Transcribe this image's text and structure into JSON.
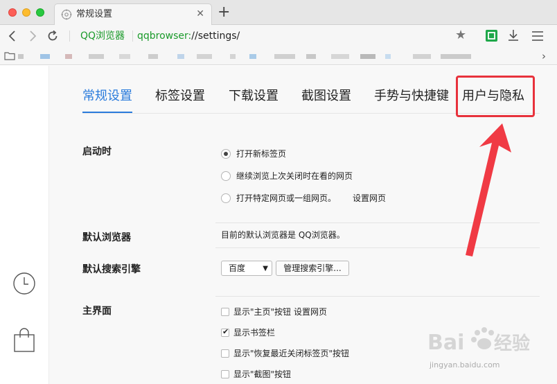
{
  "browser": {
    "tab": {
      "title": "常规设置"
    },
    "address": {
      "site_name": "QQ浏览器",
      "url_scheme": "qqbrowser:",
      "url_rest": "//settings/"
    },
    "icons": {
      "close": "close-icon",
      "new_tab": "plus-icon",
      "back": "back-arrow-icon",
      "forward": "forward-arrow-icon",
      "reload": "reload-icon",
      "star": "star-icon",
      "extension": "extension-icon",
      "download": "download-icon",
      "menu": "menu-icon",
      "bookmarks_more": "chevron-right-icon"
    },
    "symbols": {
      "close": "✕",
      "new_tab": "+",
      "star": "★",
      "more": "›"
    }
  },
  "rail": {
    "icons": [
      "clock-icon",
      "shopping-bag-icon"
    ]
  },
  "settings": {
    "tabs": [
      {
        "label": "常规设置",
        "active": true
      },
      {
        "label": "标签设置",
        "active": false
      },
      {
        "label": "下载设置",
        "active": false
      },
      {
        "label": "截图设置",
        "active": false
      },
      {
        "label": "手势与快捷键",
        "active": false
      },
      {
        "label": "用户与隐私",
        "active": false
      }
    ],
    "startup": {
      "label": "启动时",
      "options": [
        {
          "text": "打开新标签页",
          "selected": true
        },
        {
          "text": "继续浏览上次关闭时在看的网页",
          "selected": false
        },
        {
          "text": "打开特定网页或一组网页。",
          "selected": false
        }
      ],
      "set_pages_link": "设置网页"
    },
    "default_browser": {
      "label": "默认浏览器",
      "status": "目前的默认浏览器是 QQ浏览器。"
    },
    "default_search": {
      "label": "默认搜索引擎",
      "selected_engine": "百度",
      "caret": "▼",
      "manage_button": "管理搜索引擎..."
    },
    "main_ui": {
      "label": "主界面",
      "options": [
        {
          "text": "显示\"主页\"按钮",
          "checked": false
        },
        {
          "text": "显示书签栏",
          "checked": true
        },
        {
          "text": "显示\"恢复最近关闭标签页\"按钮",
          "checked": false
        },
        {
          "text": "显示\"截图\"按钮",
          "checked": false
        }
      ],
      "home_link": "设置网页"
    }
  },
  "colors": {
    "accent": "#2a7bdc",
    "brand_green": "#1a9a2a",
    "annotation_red": "#e8323c"
  },
  "watermark": {
    "url": "jingyan.baidu.com"
  }
}
